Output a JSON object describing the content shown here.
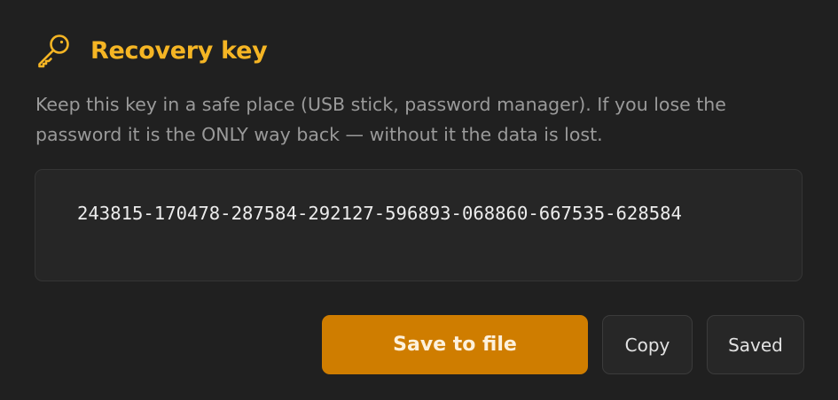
{
  "dialog": {
    "title": "Recovery key",
    "icon": "key-icon",
    "accent_color": "#f5b524",
    "description": "Keep this key in a safe place (USB stick, password manager). If you lose the\npassword it is the ONLY way back — without it the data is lost.",
    "recovery_key": "243815-170478-287584-292127-596893-068860-667535-628584"
  },
  "actions": {
    "save_label": "Save to file",
    "save_color": "#cf7d00",
    "copy_label": "Copy",
    "saved_label": "Saved"
  }
}
